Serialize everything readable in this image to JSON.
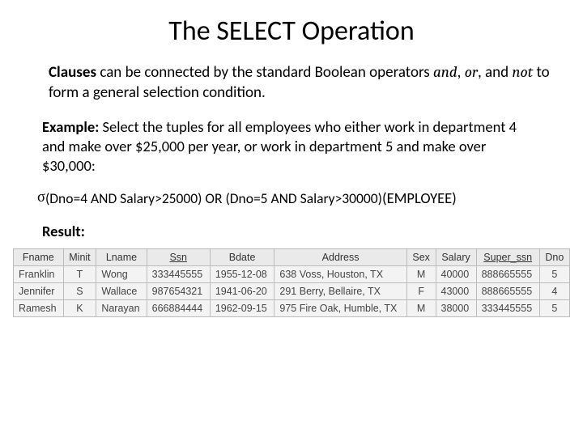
{
  "title": "The SELECT Operation",
  "intro": {
    "bold": "Clauses",
    "rest1": " can be connected by the standard Boolean operators ",
    "and": "and",
    "sep1": ", ",
    "or": "or",
    "sep2": ", and ",
    "not": "not",
    "rest2": " to form a general selection condition."
  },
  "example": {
    "label": "Example:",
    "text": " Select the tuples for all employees who either work in department 4 and make over $25,000 per year, or work in department 5 and make over $30,000:"
  },
  "formula": {
    "sigma": "σ",
    "sub": "(Dno=4 AND Salary>25000) OR (Dno=5 AND Salary>30000)",
    "arg": "(EMPLOYEE)"
  },
  "result_label": "Result:",
  "table": {
    "headers": [
      "Fname",
      "Minit",
      "Lname",
      "Ssn",
      "Bdate",
      "Address",
      "Sex",
      "Salary",
      "Super_ssn",
      "Dno"
    ],
    "underline": {
      "Ssn": true,
      "Super_ssn": true
    },
    "rows": [
      {
        "Fname": "Franklin",
        "Minit": "T",
        "Lname": "Wong",
        "Ssn": "333445555",
        "Bdate": "1955-12-08",
        "Address": "638 Voss, Houston, TX",
        "Sex": "M",
        "Salary": "40000",
        "Super_ssn": "888665555",
        "Dno": "5"
      },
      {
        "Fname": "Jennifer",
        "Minit": "S",
        "Lname": "Wallace",
        "Ssn": "987654321",
        "Bdate": "1941-06-20",
        "Address": "291 Berry, Bellaire, TX",
        "Sex": "F",
        "Salary": "43000",
        "Super_ssn": "888665555",
        "Dno": "4"
      },
      {
        "Fname": "Ramesh",
        "Minit": "K",
        "Lname": "Narayan",
        "Ssn": "666884444",
        "Bdate": "1962-09-15",
        "Address": "975 Fire Oak, Humble, TX",
        "Sex": "M",
        "Salary": "38000",
        "Super_ssn": "333445555",
        "Dno": "5"
      }
    ]
  }
}
